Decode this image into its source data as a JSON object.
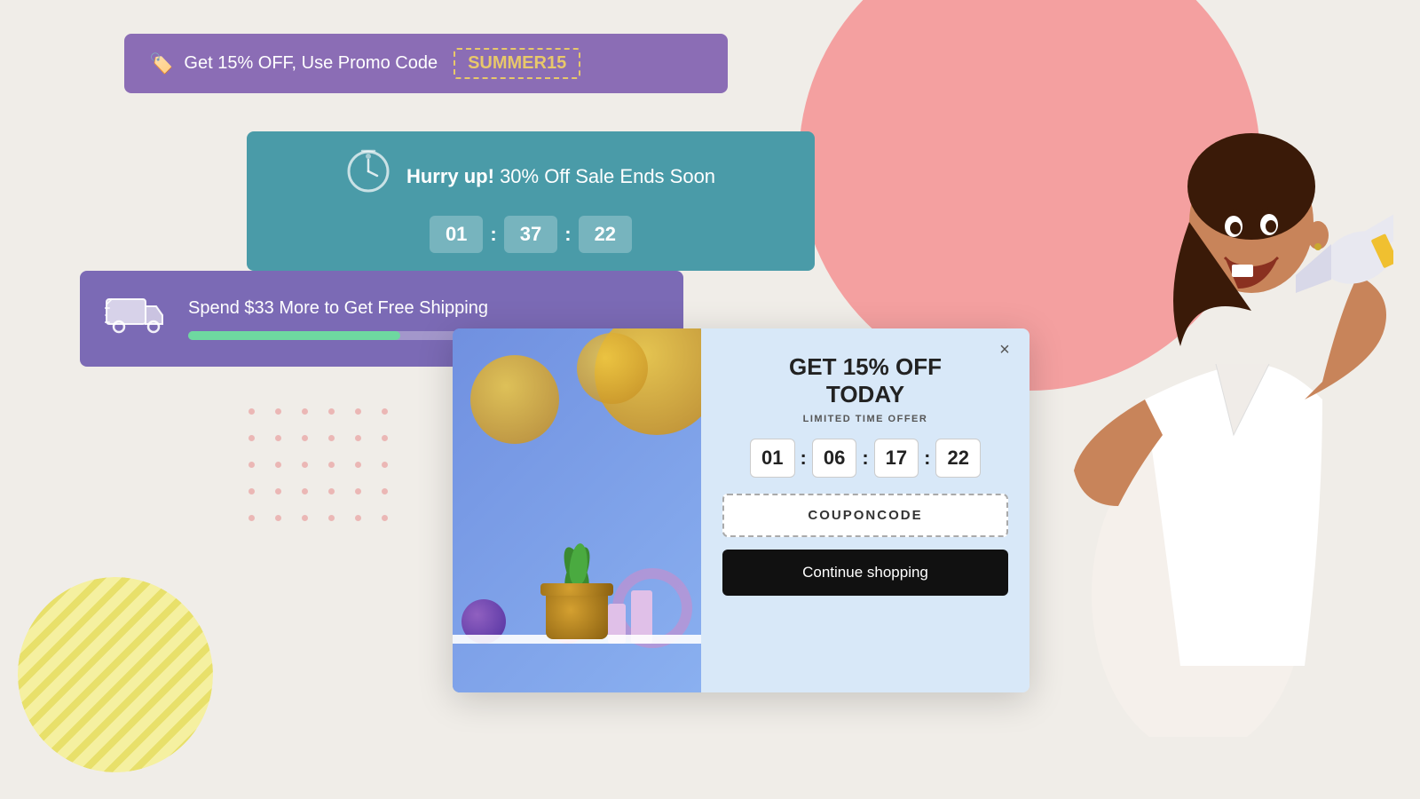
{
  "background": {
    "color": "#f0ede8"
  },
  "promo_banner": {
    "text": "Get 15% OFF, Use Promo Code",
    "code": "SUMMER15",
    "tag_icon": "🏷️"
  },
  "countdown_banner": {
    "hurry_label": "Hurry up!",
    "sale_text": " 30% Off Sale Ends Soon",
    "timer": {
      "hours": "01",
      "minutes": "37",
      "seconds": "22"
    }
  },
  "shipping_banner": {
    "text": "Spend $33 More to Get Free Shipping",
    "progress_percent": 45
  },
  "modal": {
    "title_line1": "GET 15% OFF",
    "title_line2": "TODAY",
    "subtitle": "LIMITED TIME OFFER",
    "timer": {
      "hours": "01",
      "minutes": "06",
      "colon1": ":",
      "seconds": "17",
      "colon2": ":",
      "milliseconds": "22"
    },
    "coupon_code": "COUPONCODE",
    "continue_button": "Continue shopping",
    "close_label": "×"
  }
}
